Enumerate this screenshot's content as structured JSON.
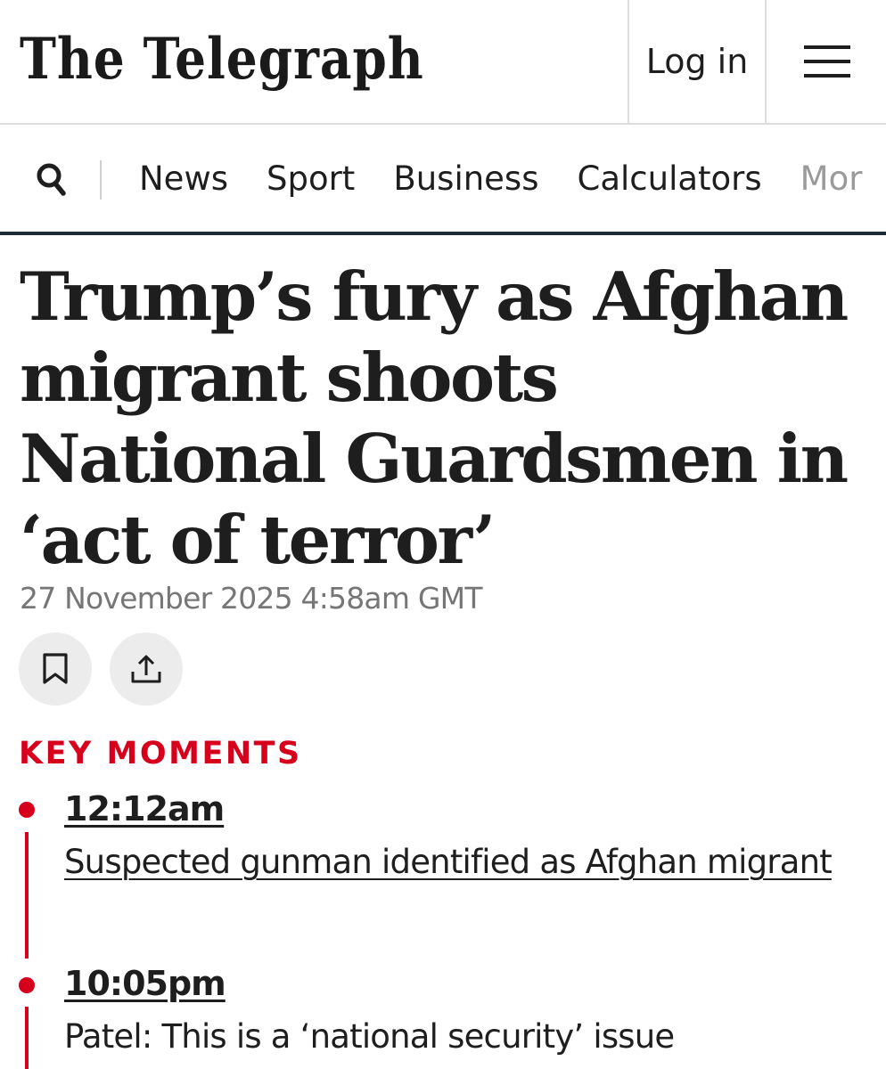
{
  "masthead": {
    "logo_text": "The Telegraph",
    "login_label": "Log in",
    "menu_icon": "hamburger-menu-icon"
  },
  "nav": {
    "search_icon": "search-icon",
    "items": [
      {
        "label": "News"
      },
      {
        "label": "Sport"
      },
      {
        "label": "Business"
      },
      {
        "label": "Calculators"
      },
      {
        "label": "Mor"
      }
    ]
  },
  "article": {
    "headline": "Trump’s fury as Afghan migrant shoots National Guardsmen in ‘act of terror’",
    "dateline": "27 November 2025 4:58am GMT",
    "actions": {
      "bookmark_icon": "bookmark-icon",
      "share_icon": "share-icon"
    }
  },
  "key_moments": {
    "heading": "KEY MOMENTS",
    "accent_color": "#d6001c",
    "items": [
      {
        "time": "12:12am",
        "title": "Suspected gunman identified as Afghan migrant",
        "linked": true
      },
      {
        "time": "10:05pm",
        "title": "Patel: This is a ‘national security’ issue",
        "linked": false
      }
    ]
  }
}
